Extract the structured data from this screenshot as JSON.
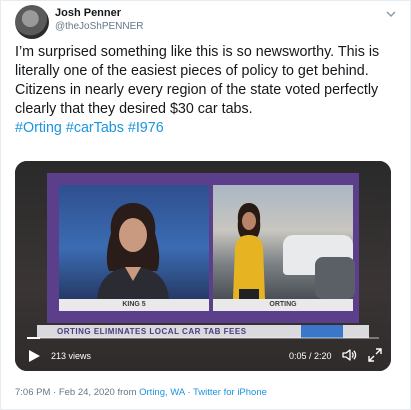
{
  "tweet": {
    "author_name": "Josh Penner",
    "author_handle": "@theJoShPENNER",
    "text": "I’m surprised something like this is so newsworthy.  This is literally one of the easiest pieces of policy to get behind.  Citizens in nearly every region of the state voted perfectly clearly that they desired $30 car tabs.",
    "hashtags": [
      "#Orting",
      "#carTabs",
      "#I976"
    ],
    "time": "7:06 PM",
    "date": "Feb 24, 2020",
    "from_label": "from",
    "location": "Orting, WA",
    "source": "Twitter for iPhone",
    "separator": "·"
  },
  "video": {
    "views": "213 views",
    "time": "0:05 / 2:20",
    "progress": 0.036,
    "screen_labels": {
      "left": "KING 5",
      "right": "ORTING"
    },
    "lower_third": "ORTING ELIMINATES LOCAL CAR TAB FEES"
  },
  "colors": {
    "link": "#1b95e0",
    "text": "#14171a",
    "muted": "#657786",
    "studio_purple": "#5b3f8a"
  },
  "icons": {
    "caret": "chevron-down-icon",
    "play": "play-icon",
    "volume": "volume-icon",
    "fullscreen": "fullscreen-icon"
  }
}
